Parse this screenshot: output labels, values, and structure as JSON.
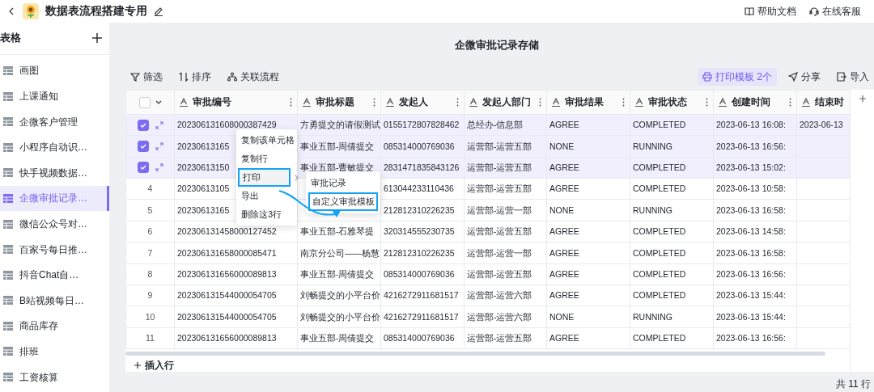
{
  "header": {
    "title": "数据表流程搭建专用",
    "links": [
      "帮助文档",
      "在线客服"
    ]
  },
  "sidebar": {
    "title": "表格",
    "items": [
      {
        "label": "画图",
        "selected": false
      },
      {
        "label": "上课通知",
        "selected": false
      },
      {
        "label": "企微客户管理",
        "selected": false
      },
      {
        "label": "小程序自动识…",
        "selected": false
      },
      {
        "label": "快手视频数据…",
        "selected": false
      },
      {
        "label": "企微审批记录…",
        "selected": true
      },
      {
        "label": "微信公众号对…",
        "selected": false
      },
      {
        "label": "百家号每日推…",
        "selected": false
      },
      {
        "label": "抖音Chat自…",
        "selected": false
      },
      {
        "label": "B站视频每日…",
        "selected": false
      },
      {
        "label": "商品库存",
        "selected": false
      },
      {
        "label": "排班",
        "selected": false
      },
      {
        "label": "工资核算",
        "selected": false
      }
    ]
  },
  "sheet_title": "企微审批记录存储",
  "toolbar": {
    "left": [
      "筛选",
      "排序",
      "关联流程"
    ],
    "print_template": "打印模板 2个",
    "right": [
      "分享",
      "导入"
    ]
  },
  "table": {
    "header_checkbox": {
      "checked": false
    },
    "columns": [
      "审批编号",
      "审批标题",
      "发起人",
      "发起人部门",
      "审批结果",
      "审批状态",
      "创建时间",
      "结束时"
    ],
    "rows": [
      {
        "selected": true,
        "cells": [
          "202306131608000387429",
          "方勇提交的请假测试",
          "0155172807828462",
          "总经办-信息部",
          "AGREE",
          "COMPLETED",
          "2023-06-13 16:08:",
          "2023-06-13"
        ]
      },
      {
        "selected": true,
        "cells": [
          "20230613165",
          "事业五部-周倩提交",
          "085314000769036",
          "运营部-运营五部",
          "NONE",
          "RUNNING",
          "2023-06-13 16:56:",
          null
        ]
      },
      {
        "selected": true,
        "cells": [
          "20230613150",
          "事业五部-曹敏提交",
          "2831471835843126",
          "运营部-运营五部",
          "AGREE",
          "COMPLETED",
          "2023-06-13 15:02:",
          null
        ]
      },
      {
        "number": "4",
        "selected": false,
        "cells": [
          "20230613105",
          null,
          "613044233110436",
          "运营部-运营五部",
          "AGREE",
          "COMPLETED",
          "2023-06-13 10:58:",
          null
        ]
      },
      {
        "number": "5",
        "selected": false,
        "cells": [
          "20230613165",
          null,
          "212812310226235",
          "运营部-运营一部",
          "NONE",
          "RUNNING",
          "2023-06-13 16:58:",
          null
        ]
      },
      {
        "number": "6",
        "selected": false,
        "cells": [
          "202306131458000127452",
          "事业五部-石雅琴提",
          "320314555230735",
          "运营部-运营五部",
          "AGREE",
          "COMPLETED",
          "2023-06-13 14:58:",
          null
        ]
      },
      {
        "number": "7",
        "selected": false,
        "cells": [
          "202306131658000085471",
          "南京分公司——杨慧",
          "212812310226235",
          "运营部-运营一部",
          "AGREE",
          "COMPLETED",
          "2023-06-13 16:58:",
          null
        ]
      },
      {
        "number": "8",
        "selected": false,
        "cells": [
          "202306131656000089813",
          "事业五部-周倩提交",
          "085314000769036",
          "运营部-运营五部",
          "AGREE",
          "COMPLETED",
          "2023-06-13 16:56:",
          null
        ]
      },
      {
        "number": "9",
        "selected": false,
        "cells": [
          "202306131544000054705",
          "刘畅提交的小平台价",
          "4216272911681517",
          "运营部-运营六部",
          "AGREE",
          "COMPLETED",
          "2023-06-13 15:44:",
          null
        ]
      },
      {
        "number": "10",
        "selected": false,
        "cells": [
          "202306131544000054705",
          "刘畅提交的小平台价",
          "4216272911681517",
          "运营部-运营六部",
          "NONE",
          "RUNNING",
          "2023-06-13 15:44:",
          null
        ]
      },
      {
        "number": "11",
        "selected": false,
        "cells": [
          "202306131656000089813",
          "事业五部-周倩提交",
          "085314000769036",
          "运营部-运营五部",
          "AGREE",
          "COMPLETED",
          "2023-06-13 16:56:",
          null
        ]
      }
    ],
    "insert_row": "插入行"
  },
  "context_menu": {
    "items": [
      {
        "label": "复制该单元格",
        "highlighted": false,
        "submenu": false
      },
      {
        "label": "复制行",
        "highlighted": false,
        "submenu": false
      },
      {
        "label": "打印",
        "highlighted": true,
        "submenu": true
      },
      {
        "label": "导出",
        "highlighted": false,
        "submenu": false
      },
      {
        "label": "删除这3行",
        "highlighted": false,
        "submenu": false
      }
    ],
    "submenu": [
      {
        "label": "审批记录",
        "highlighted": false
      },
      {
        "label": "自定义审批模板",
        "highlighted": true
      }
    ]
  },
  "footer": "共 11 行"
}
